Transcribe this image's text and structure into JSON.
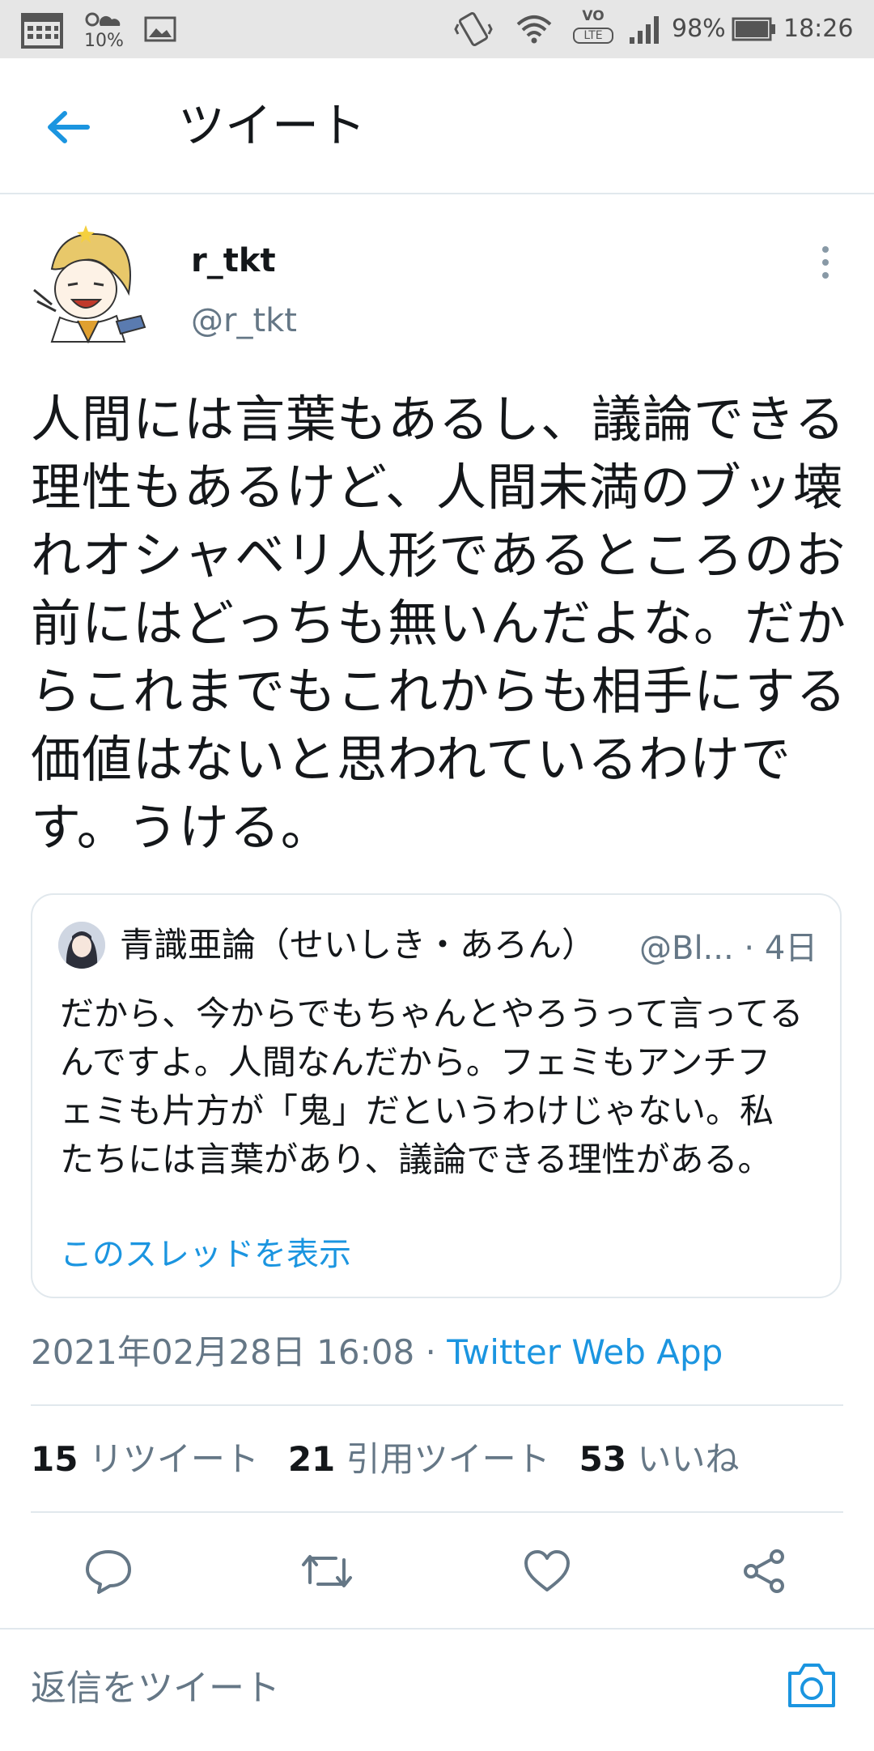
{
  "status_bar": {
    "weather_percent": "10%",
    "battery": "98%",
    "time": "18:26",
    "network": "LTE"
  },
  "header": {
    "title": "ツイート"
  },
  "tweet": {
    "display_name": "r_tkt",
    "handle": "@r_tkt",
    "text": "人間には言葉もあるし、議論できる理性もあるけど、人間未満のブッ壊れオシャベリ人形であるところのお前にはどっちも無いんだよな。だからこれまでもこれからも相手にする価値はないと思われているわけです。うける。",
    "timestamp": "2021年02月28日 16:08 · ",
    "app": "Twitter Web App"
  },
  "quote": {
    "name": "青識亜論（せいしき・あろん）",
    "handle_short": "@Bl...",
    "age": "· 4日",
    "text": "だから、今からでもちゃんとやろうって言ってるんですよ。人間なんだから。フェミもアンチフェミも片方が「鬼」だというわけじゃない。私たちには言葉があり、議論できる理性がある。",
    "show_thread": "このスレッドを表示"
  },
  "stats": {
    "retweets_count": "15",
    "retweets_label": "リツイート",
    "quotes_count": "21",
    "quotes_label": "引用ツイート",
    "likes_count": "53",
    "likes_label": "いいね"
  },
  "reply": {
    "placeholder": "返信をツイート"
  },
  "colors": {
    "accent": "#1b95e0",
    "secondary_text": "#657786",
    "border": "#e1e8ed"
  }
}
